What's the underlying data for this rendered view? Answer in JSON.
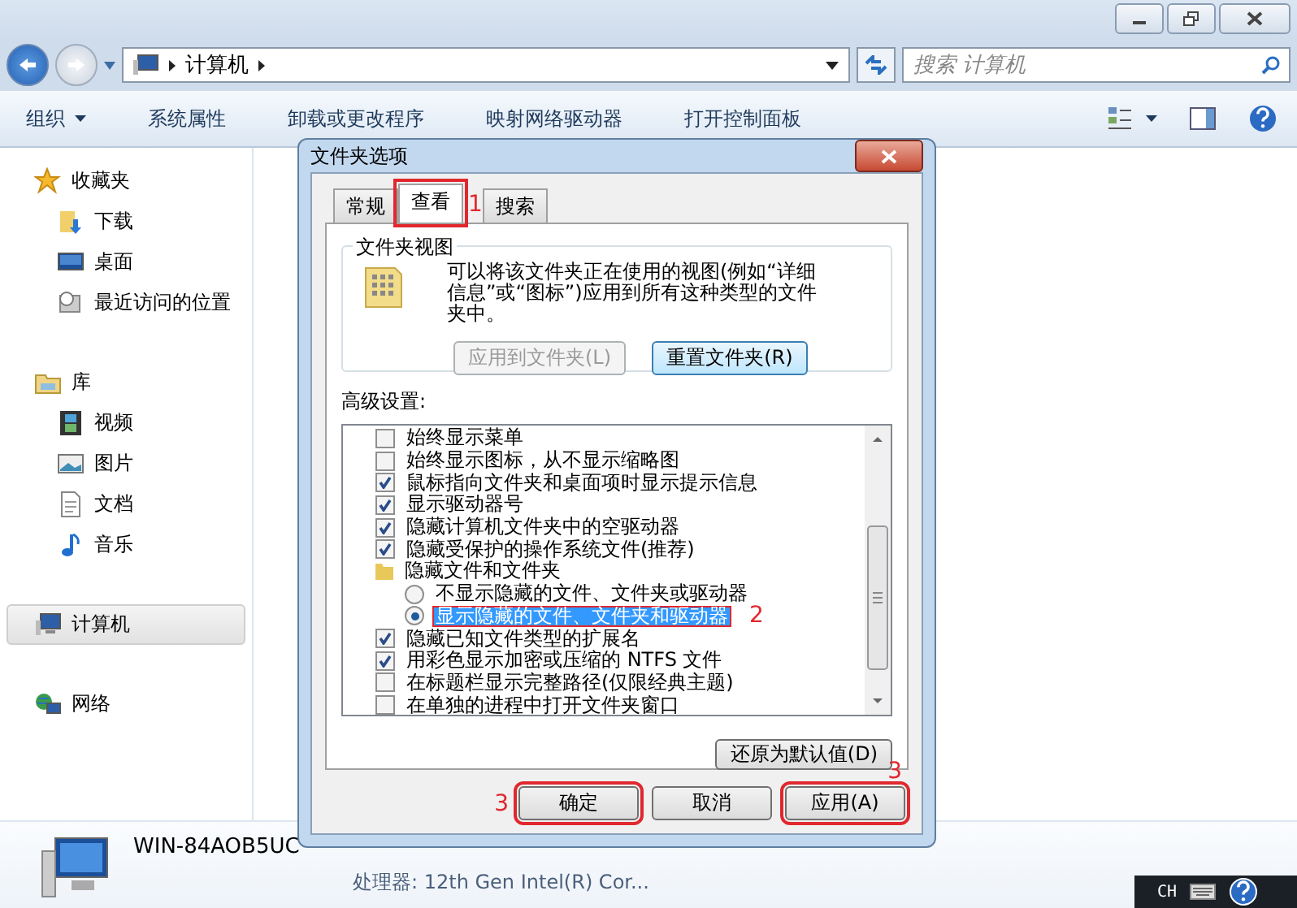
{
  "window": {
    "address": [
      "计算机"
    ],
    "search": {
      "placeholder": "搜索 计算机"
    }
  },
  "toolbar": [
    {
      "label": "组织",
      "dropdown": true
    },
    {
      "label": "系统属性",
      "dropdown": false
    },
    {
      "label": "卸载或更改程序",
      "dropdown": false
    },
    {
      "label": "映射网络驱动器",
      "dropdown": false
    },
    {
      "label": "打开控制面板",
      "dropdown": false
    }
  ],
  "sidebar": [
    {
      "label": "收藏夹",
      "selected": false,
      "children": [
        {
          "label": "下载",
          "selected": false
        },
        {
          "label": "桌面",
          "selected": false
        },
        {
          "label": "最近访问的位置",
          "selected": false
        }
      ]
    },
    {
      "label": "库",
      "selected": false,
      "children": [
        {
          "label": "视频",
          "selected": false
        },
        {
          "label": "图片",
          "selected": false
        },
        {
          "label": "文档",
          "selected": false
        },
        {
          "label": "音乐",
          "selected": false
        }
      ]
    },
    {
      "label": "计算机",
      "selected": true
    },
    {
      "label": "网络",
      "selected": false
    }
  ],
  "details": {
    "name": "WIN-84AOB5UC",
    "processor": "处理器: 12th Gen Intel(R) Cor..."
  },
  "dialog": {
    "title": "文件夹选项",
    "tabs": [
      {
        "label": "常规",
        "selected": false
      },
      {
        "label": "查看",
        "selected": true,
        "annotation": "1"
      },
      {
        "label": "搜索",
        "selected": false
      }
    ],
    "folder_views": {
      "title": "文件夹视图",
      "description": "可以将该文件夹正在使用的视图(例如“详细信息”或“图标”)应用到所有这种类型的文件夹中。",
      "buttons": [
        {
          "label": "应用到文件夹(L)",
          "disabled": true
        },
        {
          "label": "重置文件夹(R)",
          "disabled": false
        }
      ]
    },
    "advanced": {
      "label": "高级设置:",
      "items": [
        {
          "kind": "checkbox",
          "label": "始终显示菜单",
          "checked": false
        },
        {
          "kind": "checkbox",
          "label": "始终显示图标，从不显示缩略图",
          "checked": false
        },
        {
          "kind": "checkbox",
          "label": "鼠标指向文件夹和桌面项时显示提示信息",
          "checked": true
        },
        {
          "kind": "checkbox",
          "label": "显示驱动器号",
          "checked": true
        },
        {
          "kind": "checkbox",
          "label": "隐藏计算机文件夹中的空驱动器",
          "checked": true
        },
        {
          "kind": "checkbox",
          "label": "隐藏受保护的操作系统文件(推荐)",
          "checked": true
        },
        {
          "kind": "folder",
          "label": "隐藏文件和文件夹",
          "children": [
            {
              "kind": "radio",
              "label": "不显示隐藏的文件、文件夹或驱动器",
              "selected": false
            },
            {
              "kind": "radio",
              "label": "显示隐藏的文件、文件夹和驱动器",
              "selected": true,
              "annotation": "2"
            }
          ]
        },
        {
          "kind": "checkbox",
          "label": "隐藏已知文件类型的扩展名",
          "checked": true
        },
        {
          "kind": "checkbox",
          "label": "用彩色显示加密或压缩的 NTFS 文件",
          "checked": true
        },
        {
          "kind": "checkbox",
          "label": "在标题栏显示完整路径(仅限经典主题)",
          "checked": false
        },
        {
          "kind": "checkbox",
          "label": "在单独的进程中打开文件夹窗口",
          "checked": false
        }
      ]
    },
    "restore_button": "还原为默认值(D)",
    "buttons": [
      {
        "label": "确定",
        "annotation": "3"
      },
      {
        "label": "取消"
      },
      {
        "label": "应用(A)",
        "annotation": "3"
      }
    ]
  },
  "tray": {
    "language": "CH"
  }
}
